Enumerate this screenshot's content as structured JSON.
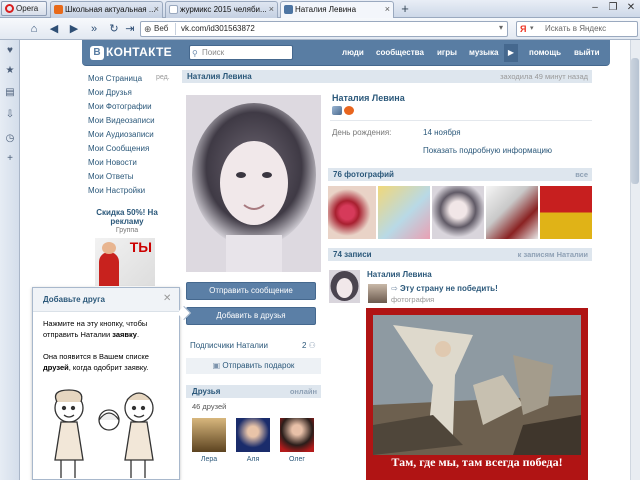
{
  "browser": {
    "opera_label": "Opera",
    "tabs": [
      {
        "title": "Школьная актуальная ...",
        "icon_color": "#e86a1a"
      },
      {
        "title": "журмикс 2015 челяби...",
        "icon_color": "#cfd6df"
      },
      {
        "title": "Наталия Левина",
        "icon_color": "#4d75a3"
      }
    ],
    "new_tab": "+",
    "url_badge": "Веб",
    "url": "vk.com/id301563872",
    "search_placeholder": "Искать в Яндекс",
    "yandex_glyph": "Я"
  },
  "vk": {
    "logo_letter": "В",
    "logo_text": "КОНТАКТЕ",
    "search_placeholder": "Поиск",
    "nav": [
      "люди",
      "сообщества",
      "игры",
      "музыка",
      "помощь",
      "выйти"
    ],
    "menu": [
      "Моя Страница",
      "Мои Друзья",
      "Мои Фотографии",
      "Мои Видеозаписи",
      "Мои Аудиозаписи",
      "Мои Сообщения",
      "Мои Новости",
      "Мои Ответы",
      "Мои Настройки"
    ],
    "menu_edit": "ред.",
    "promo": {
      "title": "Скидка 50%! На рекламу",
      "subtitle": "Группа",
      "poster_text": "ТЫ"
    },
    "tooltip": {
      "title": "Добавьте друга",
      "close": "✕",
      "p1_a": "Нажмите на эту кнопку, чтобы отправить Наталии ",
      "p1_b": "заявку",
      "p1_c": ".",
      "p2_a": "Она появится в Вашем списке ",
      "p2_b": "друзей",
      "p2_c": ", когда одобрит заявку."
    },
    "profile": {
      "header_name": "Наталия Левина",
      "header_status": "заходила 49 минут назад",
      "name": "Наталия Левина",
      "birthday_label": "День рождения:",
      "birthday_value": "14 ноября",
      "more_info": "Показать подробную информацию"
    },
    "buttons": {
      "message": "Отправить сообщение",
      "add_friend": "Добавить в друзья"
    },
    "subscribers": {
      "label": "Подписчики Наталии",
      "count": "2"
    },
    "gift": "Отправить подарок",
    "friends": {
      "title": "Друзья",
      "all": "онлайн",
      "count": "46 друзей",
      "items": [
        "Лера",
        "Аля",
        "Олег"
      ]
    },
    "photos": {
      "title": "76 фотографий",
      "all": "все"
    },
    "posts": {
      "title": "74 записи",
      "right": "к записям Наталии",
      "author": "Наталия Левина",
      "repost_text": "Эту страну не победить!",
      "repost_sub": "фотография",
      "caption": "Там, где мы, там всегда победа!"
    },
    "colors": {
      "header_blue": "#597da3",
      "link_blue": "#2b587a",
      "bar_gray": "#dee6ee",
      "poster_red": "#b01414"
    }
  }
}
